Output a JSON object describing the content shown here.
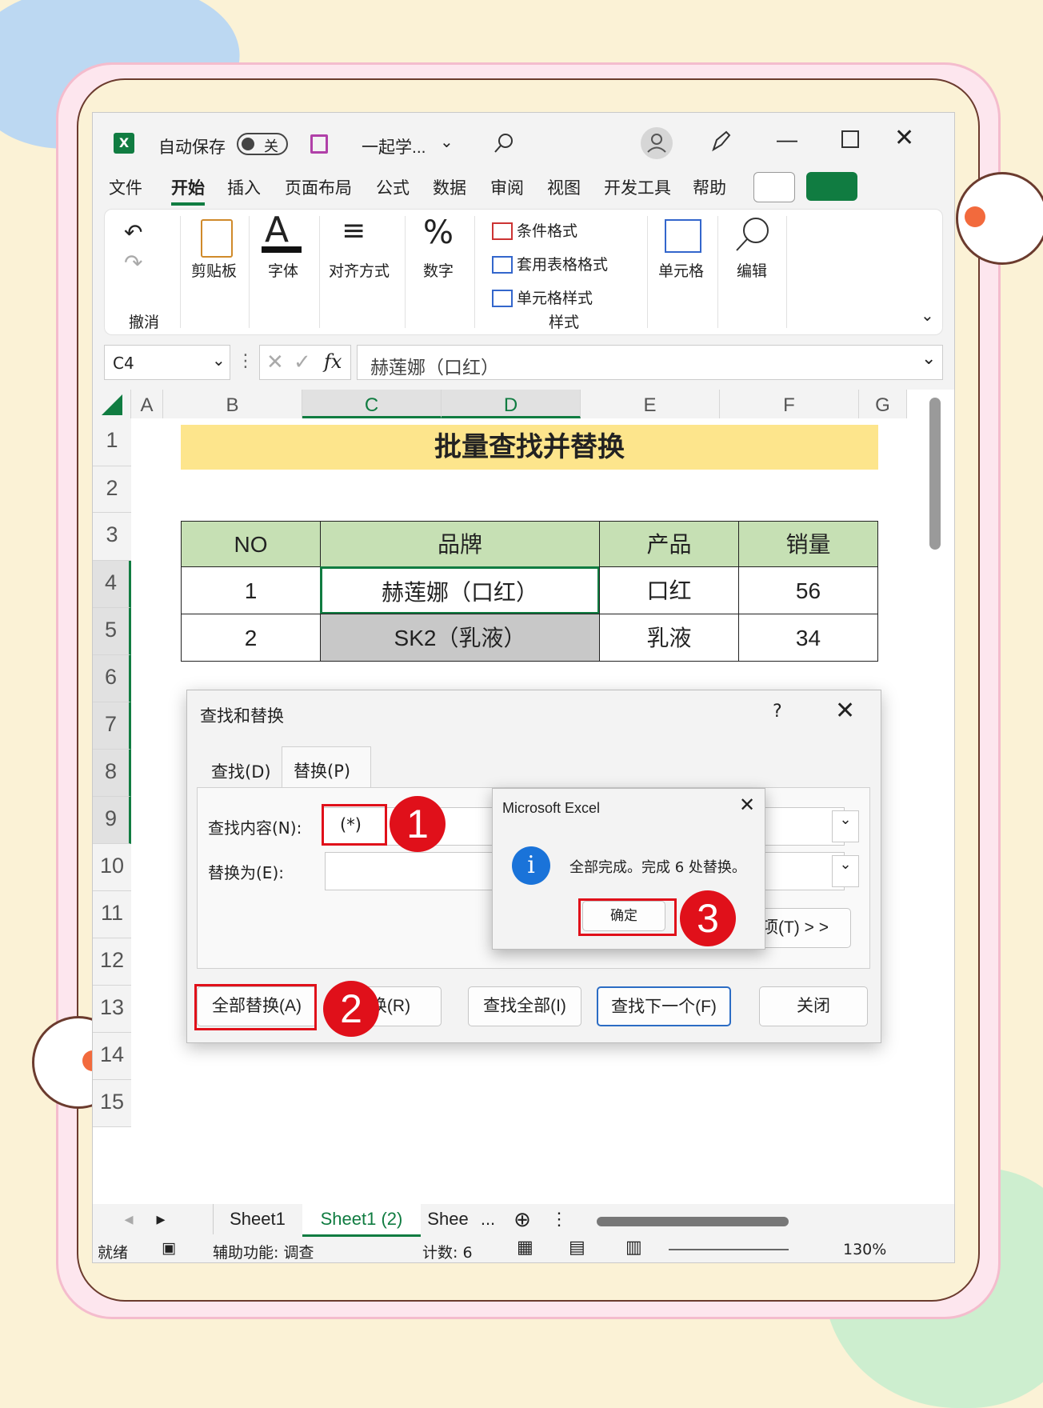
{
  "titlebar": {
    "autosave_label": "自动保存",
    "autosave_state": "关",
    "filename": "一起学..."
  },
  "menu": [
    "文件",
    "开始",
    "插入",
    "页面布局",
    "公式",
    "数据",
    "审阅",
    "视图",
    "开发工具",
    "帮助"
  ],
  "ribbon": {
    "undo_group": "撤消",
    "clipboard": "剪贴板",
    "font": "字体",
    "align": "对齐方式",
    "number": "数字",
    "cond_format": "条件格式",
    "table_format": "套用表格格式",
    "cell_style": "单元格样式",
    "styles_group": "样式",
    "cells": "单元格",
    "edit": "编辑"
  },
  "formula_bar": {
    "name_box": "C4",
    "fx": "fx",
    "content": "赫莲娜（口红）"
  },
  "columns": [
    "A",
    "B",
    "C",
    "D",
    "E",
    "F",
    "G"
  ],
  "rows": [
    "1",
    "2",
    "3",
    "4",
    "5",
    "6",
    "7",
    "8",
    "9",
    "10",
    "11",
    "12",
    "13",
    "14",
    "15"
  ],
  "sheet": {
    "title": "批量查找并替换",
    "headers": [
      "NO",
      "品牌",
      "产品",
      "销量"
    ],
    "row4": [
      "1",
      "赫莲娜（口红）",
      "口红",
      "56"
    ],
    "row5": [
      "2",
      "SK2（乳液）",
      "乳液",
      "34"
    ]
  },
  "tabs": {
    "sheet1": "Sheet1",
    "sheet2": "Sheet1 (2)",
    "sheet3": "Shee",
    "more": "..."
  },
  "status": {
    "ready": "就绪",
    "accessibility": "辅助功能: 调查",
    "count": "计数: 6",
    "zoom": "130%"
  },
  "dialog": {
    "title": "查找和替换",
    "help": "?",
    "tab_find": "查找(D)",
    "tab_replace": "替换(P)",
    "find_label": "查找内容(N):",
    "find_value": "(*)",
    "replace_label": "替换为(E):",
    "replace_value": "",
    "options_btn": "项(T) > >",
    "replace_all_btn": "全部替换(A)",
    "replace_btn": "换(R)",
    "find_all_btn": "查找全部(I)",
    "find_next_btn": "查找下一个(F)",
    "close_btn": "关闭"
  },
  "msgbox": {
    "title": "Microsoft Excel",
    "text": "全部完成。完成 6 处替换。",
    "ok": "确定"
  },
  "badges": [
    "1",
    "2",
    "3"
  ],
  "colors": {
    "excel_green": "#107c41",
    "title_fill": "#fde58c",
    "header_fill": "#c6e0b4",
    "highlight_red": "#e0101a",
    "selected_cell": "#c8c8c8"
  }
}
